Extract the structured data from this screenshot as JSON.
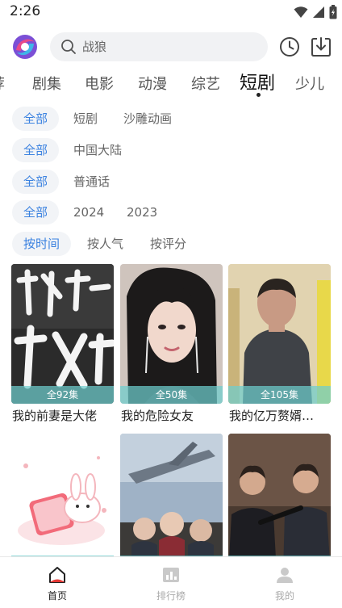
{
  "status_bar": {
    "time": "2:26"
  },
  "search": {
    "placeholder": "战狼"
  },
  "category_tabs": [
    {
      "label": "荐"
    },
    {
      "label": "剧集"
    },
    {
      "label": "电影"
    },
    {
      "label": "动漫"
    },
    {
      "label": "综艺"
    },
    {
      "label": "短剧",
      "active": true
    },
    {
      "label": "少儿"
    }
  ],
  "filters": {
    "type": {
      "all": "全部",
      "options": [
        "短剧",
        "沙雕动画"
      ]
    },
    "region": {
      "all": "全部",
      "options": [
        "中国大陆"
      ]
    },
    "language": {
      "all": "全部",
      "options": [
        "普通话"
      ]
    },
    "year": {
      "all": "全部",
      "options": [
        "2024",
        "2023"
      ]
    },
    "sort": {
      "selected": "按时间",
      "options": [
        "按人气",
        "按评分"
      ]
    }
  },
  "cards": [
    {
      "title": "我的前妻是大佬",
      "episodes": "全92集"
    },
    {
      "title": "我的危险女友",
      "episodes": "全50集"
    },
    {
      "title": "我的亿万赘婿…",
      "episodes": "全105集"
    }
  ],
  "bottom_nav": [
    {
      "label": "首页",
      "active": true
    },
    {
      "label": "排行榜"
    },
    {
      "label": "我的"
    }
  ],
  "colors": {
    "accent_blue": "#3b82e0",
    "chip_bg": "#f2f4f7",
    "episode_band": "#6ecdcd"
  }
}
